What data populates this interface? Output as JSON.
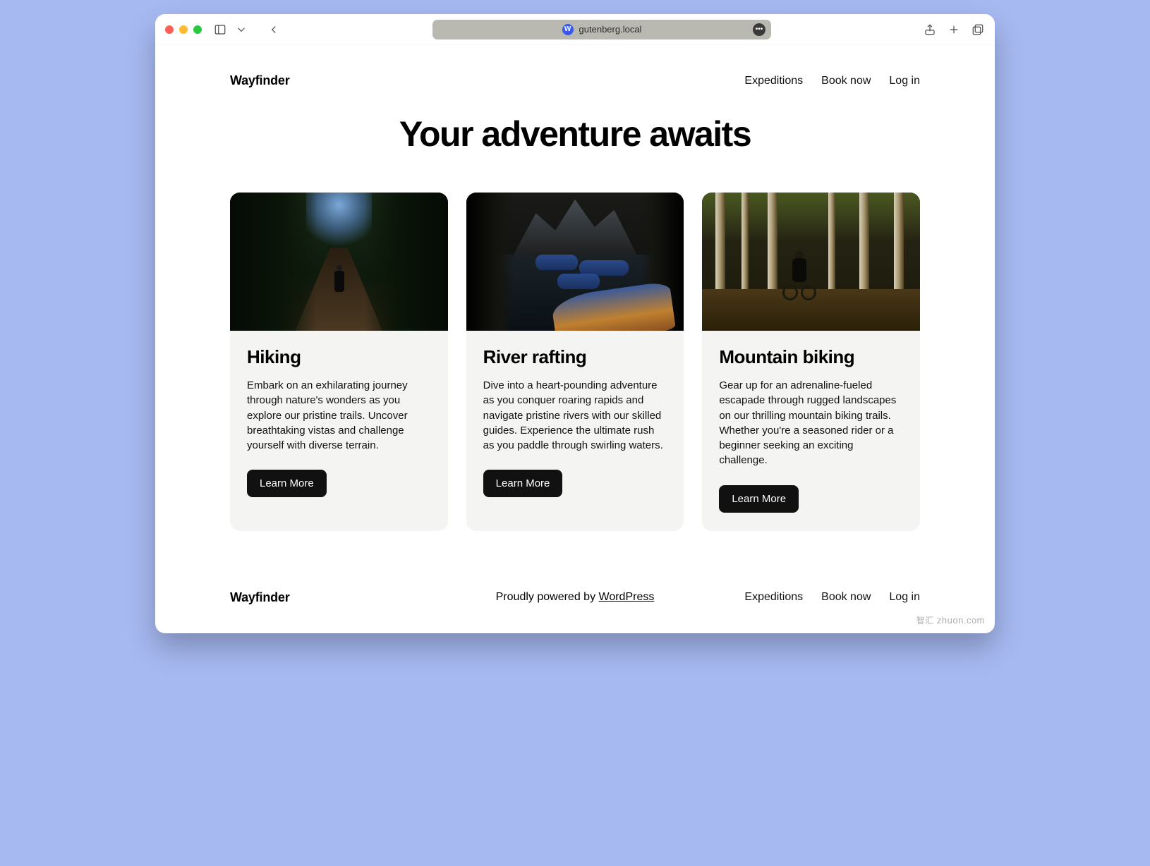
{
  "browser": {
    "url": "gutenberg.local"
  },
  "site": {
    "title": "Wayfinder",
    "nav": [
      {
        "label": "Expeditions"
      },
      {
        "label": "Book now"
      },
      {
        "label": "Log in"
      }
    ]
  },
  "hero": {
    "title": "Your adventure awaits"
  },
  "cards": [
    {
      "title": "Hiking",
      "desc": "Embark on an exhilarating journey through nature's wonders as you explore our pristine trails. Uncover breathtaking vistas and challenge yourself with diverse terrain.",
      "cta": "Learn More",
      "image": "forest-trail-hiker"
    },
    {
      "title": "River rafting",
      "desc": "Dive into a heart-pounding adventure as you conquer roaring rapids and navigate pristine rivers with our skilled guides. Experience the ultimate rush as you paddle through swirling waters.",
      "cta": "Learn More",
      "image": "river-rafts-canyon"
    },
    {
      "title": "Mountain biking",
      "desc": "Gear up for an adrenaline-fueled escapade through rugged landscapes on our thrilling mountain biking trails. Whether you're a seasoned rider or a beginner seeking an exciting challenge.",
      "cta": "Learn More",
      "image": "aspen-forest-biker"
    }
  ],
  "footer": {
    "site_title": "Wayfinder",
    "powered_prefix": "Proudly powered by ",
    "powered_link": "WordPress",
    "nav": [
      {
        "label": "Expeditions"
      },
      {
        "label": "Book now"
      },
      {
        "label": "Log in"
      }
    ]
  },
  "watermark": {
    "cn": "智汇",
    "en": "zhuon.com"
  }
}
